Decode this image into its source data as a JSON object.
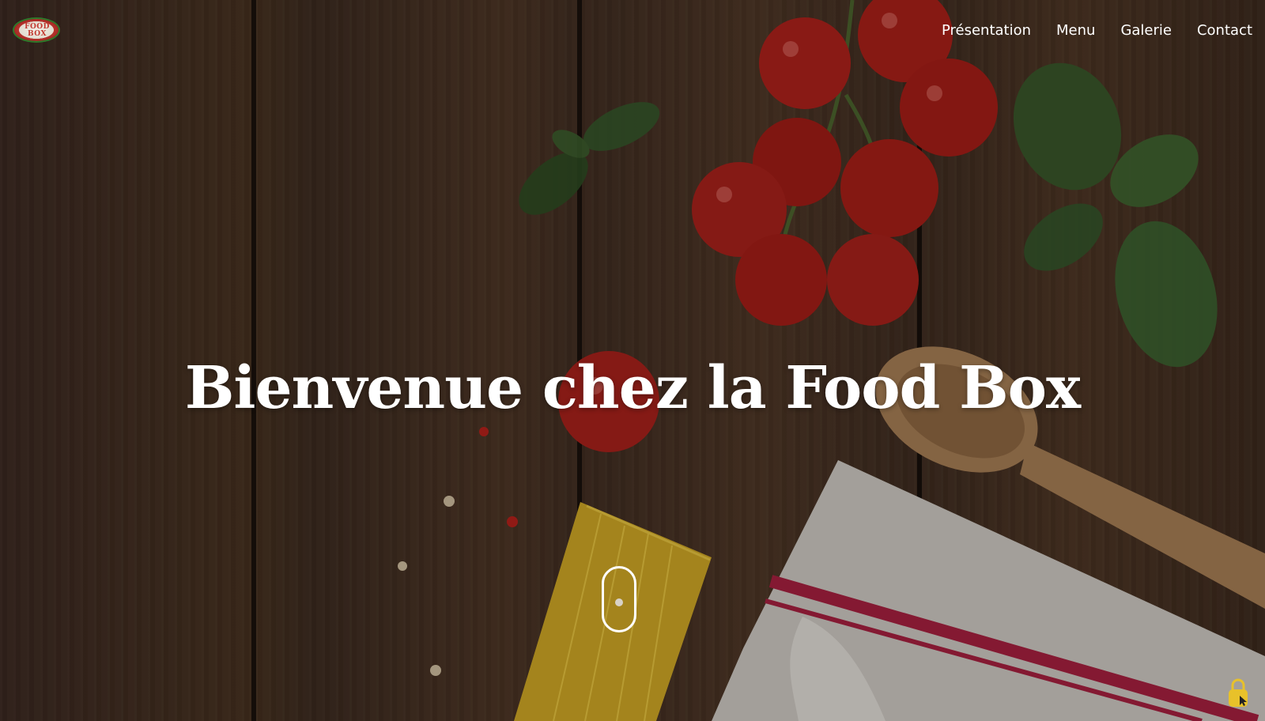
{
  "header": {
    "logo_text": "FOOD BOX",
    "nav": [
      {
        "label": "Présentation"
      },
      {
        "label": "Menu"
      },
      {
        "label": "Galerie"
      },
      {
        "label": "Contact"
      }
    ]
  },
  "hero": {
    "title": "Bienvenue chez la Food Box"
  },
  "colors": {
    "text": "#ffffff",
    "accent_lock": "#e8c12a"
  },
  "icons": {
    "scroll": "scroll-mouse-icon",
    "lock": "lock-icon"
  }
}
